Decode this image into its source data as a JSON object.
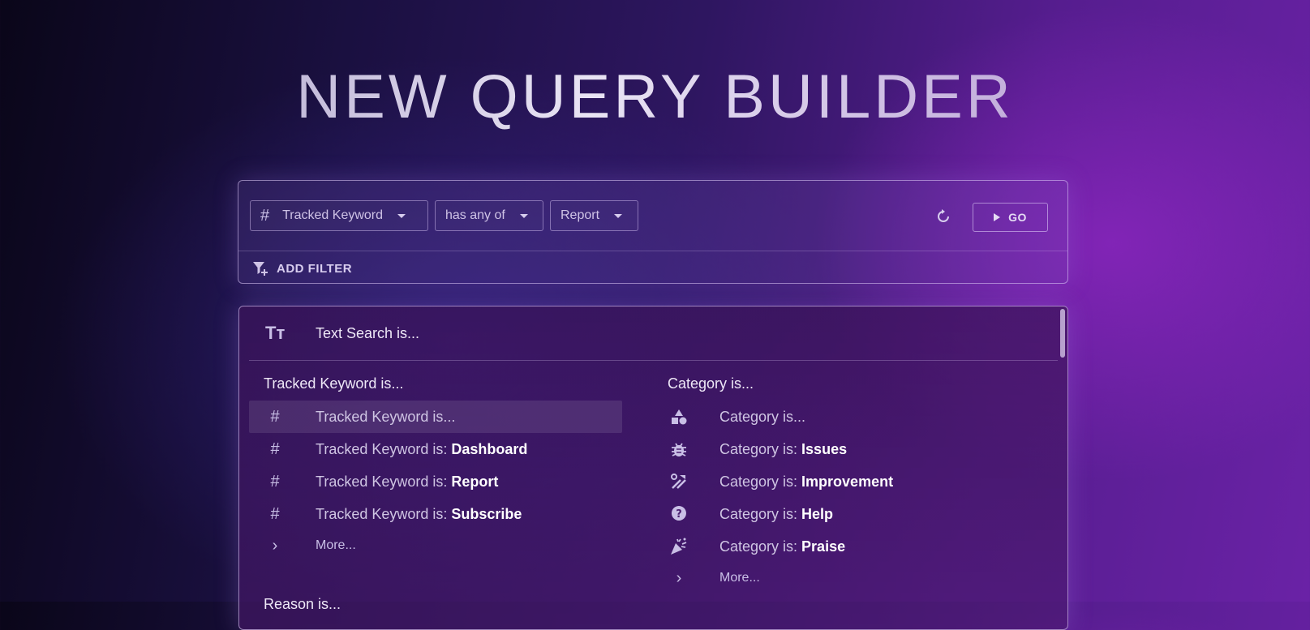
{
  "title": "NEW QUERY BUILDER",
  "query": {
    "field_label": "Tracked Keyword",
    "operator_label": "has any of",
    "value_label": "Report",
    "go_label": "GO",
    "add_filter_label": "ADD FILTER"
  },
  "dropdown": {
    "text_search_label": "Text Search is...",
    "tracked": {
      "heading": "Tracked Keyword is...",
      "items": [
        {
          "prefix": "Tracked Keyword is...",
          "value": ""
        },
        {
          "prefix": "Tracked Keyword is: ",
          "value": "Dashboard"
        },
        {
          "prefix": "Tracked Keyword is: ",
          "value": "Report"
        },
        {
          "prefix": "Tracked Keyword is: ",
          "value": "Subscribe"
        }
      ],
      "more_label": "More..."
    },
    "category": {
      "heading": "Category is...",
      "items": [
        {
          "prefix": "Category is...",
          "value": "",
          "icon": "shapes-icon"
        },
        {
          "prefix": "Category is: ",
          "value": "Issues",
          "icon": "bug-icon"
        },
        {
          "prefix": "Category is: ",
          "value": "Improvement",
          "icon": "tools-icon"
        },
        {
          "prefix": "Category is: ",
          "value": "Help",
          "icon": "help-icon"
        },
        {
          "prefix": "Category is: ",
          "value": "Praise",
          "icon": "party-icon"
        }
      ],
      "more_label": "More..."
    },
    "partial_heading": "Reason is..."
  }
}
